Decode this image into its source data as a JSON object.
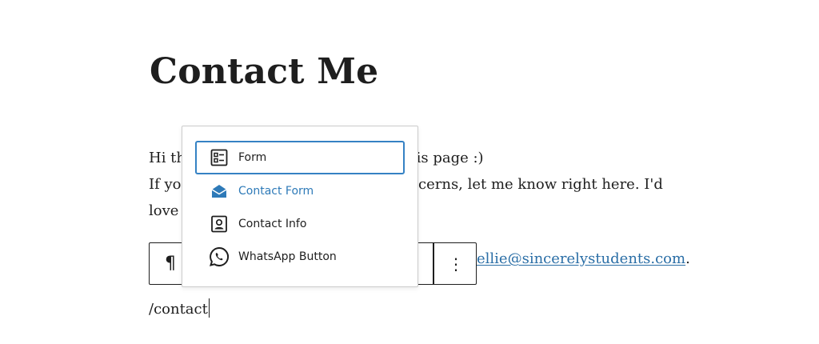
{
  "page": {
    "title": "Contact Me"
  },
  "paragraph": {
    "line1": "Hi th",
    "line1_tail": "his page :)",
    "line2": "If yo",
    "line2_tail": "concerns, let me know right here. I'd",
    "line3": "love"
  },
  "block_toolbar": {
    "paragraph_icon": "¶",
    "more_icon": "⋮"
  },
  "email_line": {
    "link": "ellie@sincerelystudents.com",
    "suffix": "."
  },
  "editor": {
    "slash_text": "/contact"
  },
  "autocomplete": {
    "options": [
      {
        "label": "Form",
        "icon": "form-icon",
        "selected": true
      },
      {
        "label": "Contact Form",
        "icon": "envelope-open-icon",
        "selected": false
      },
      {
        "label": "Contact Info",
        "icon": "contact-card-icon",
        "selected": false
      },
      {
        "label": "WhatsApp Button",
        "icon": "whatsapp-icon",
        "selected": false
      }
    ]
  },
  "colors": {
    "accent": "#3582c4",
    "link": "#2a6ea6",
    "text": "#1e1e1e"
  }
}
